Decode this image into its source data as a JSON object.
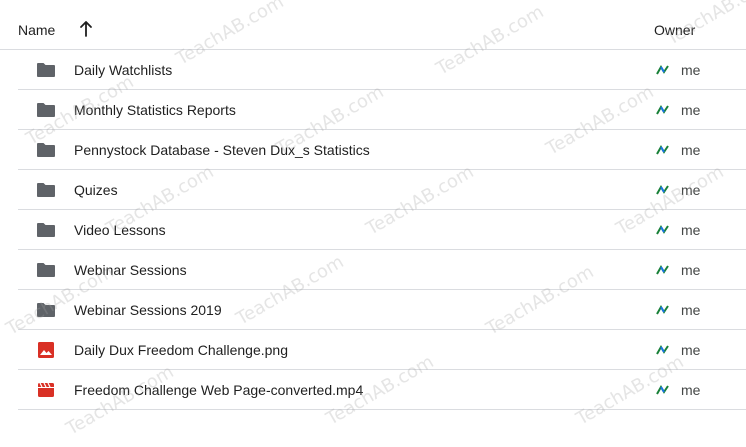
{
  "header": {
    "name_label": "Name",
    "owner_label": "Owner",
    "sort_icon": "arrow-up-icon"
  },
  "rows": [
    {
      "type": "folder",
      "icon": "folder-icon",
      "name": "Daily Watchlists",
      "owner": "me"
    },
    {
      "type": "folder",
      "icon": "folder-icon",
      "name": "Monthly Statistics Reports",
      "owner": "me"
    },
    {
      "type": "folder",
      "icon": "folder-icon",
      "name": "Pennystock Database - Steven Dux_s Statistics",
      "owner": "me"
    },
    {
      "type": "folder",
      "icon": "folder-icon",
      "name": "Quizes",
      "owner": "me"
    },
    {
      "type": "folder",
      "icon": "folder-icon",
      "name": "Video Lessons",
      "owner": "me"
    },
    {
      "type": "folder",
      "icon": "folder-icon",
      "name": "Webinar Sessions",
      "owner": "me"
    },
    {
      "type": "folder",
      "icon": "folder-icon",
      "name": "Webinar Sessions 2019",
      "owner": "me"
    },
    {
      "type": "image",
      "icon": "image-file-icon",
      "name": "Daily Dux Freedom Challenge.png",
      "owner": "me"
    },
    {
      "type": "video",
      "icon": "video-file-icon",
      "name": "Freedom Challenge Web Page-converted.mp4",
      "owner": "me"
    }
  ],
  "watermark_text": "TeachAB.com",
  "colors": {
    "folder": "#5f6368",
    "image": "#d93025",
    "video": "#d93025",
    "divider": "#dadce0"
  }
}
